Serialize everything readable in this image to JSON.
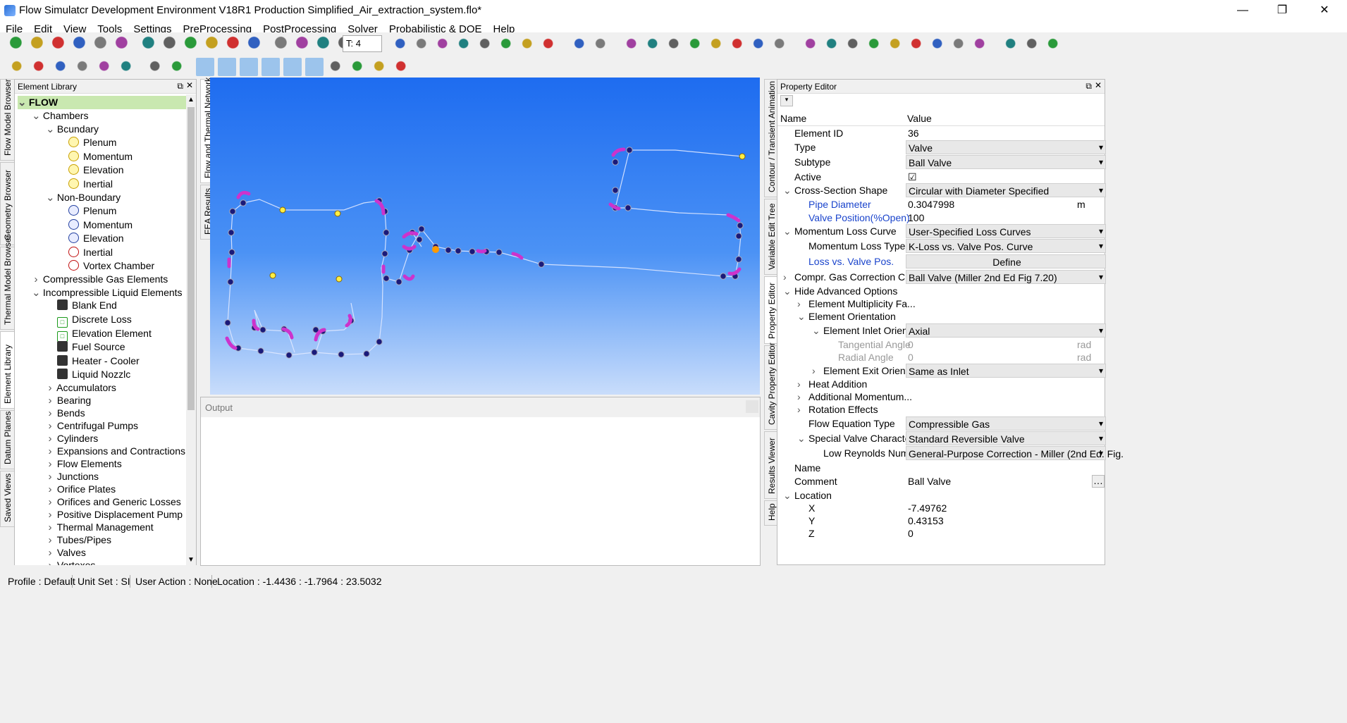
{
  "title": "Flow Simulatcr Development Environment V18R1 Production Simplified_Air_extraction_system.flo*",
  "menu": [
    "File",
    "Edit",
    "View",
    "Tools",
    "Settings",
    "PreProcessing",
    "PostProcessing",
    "Solver",
    "Probabilistic & DOE",
    "Help"
  ],
  "toolbar": {
    "text_size": "T: 4"
  },
  "left_tabs": [
    "Flow Model Browser",
    "Geometry Browser",
    "Thermal Model Browser",
    "Element Library",
    "Datum Planes",
    "Saved Views"
  ],
  "library": {
    "title": "Element Library",
    "root": "FLOW",
    "chambers": "Chambers",
    "boundary": "Bcundary",
    "boundary_items": [
      "Plenum",
      "Momentum",
      "Elevation",
      "Inertial"
    ],
    "nonboundary": "Non-Boundary",
    "nonboundary_items": [
      "Plenum",
      "Momentum",
      "Elevation",
      "Inertial",
      "Vortex Chamber"
    ],
    "compressible": "Compressible Gas Elements",
    "incompressible": "Incompressible Liquid Elements",
    "liquid_items": [
      "Blank End",
      "Discrete Loss",
      "Elevation Element",
      "Fuel Source",
      "Heater - Cooler",
      "Liquid Nozzlc"
    ],
    "groups": [
      "Accumulators",
      "Bearing",
      "Bends",
      "Centrifugal Pumps",
      "Cylinders",
      "Expansions and Contractions",
      "Flow Elements",
      "Junctions",
      "Orifice Plates",
      "Orifices and Generic Losses",
      "Positive Displacement Pump",
      "Thermal Management",
      "Tubes/Pipes",
      "Valves",
      "Vortexes"
    ]
  },
  "mid_tabs": [
    "Flow and Thermal Network",
    "FEA Results"
  ],
  "output": {
    "title": "Output"
  },
  "right_tabs": [
    "Contour / Transient Animation",
    "Variable Edit Tree",
    "Property Editor",
    "Cavity Property Editor",
    "Results Viewer",
    "Help"
  ],
  "props": {
    "title": "Property Editor",
    "col_name": "Name",
    "col_value": "Value",
    "rows": [
      {
        "n": "Element ID",
        "v": "36",
        "lvl": 1
      },
      {
        "n": "Type",
        "v": "Valve",
        "lvl": 1,
        "dd": true
      },
      {
        "n": "Subtype",
        "v": "Ball Valve",
        "lvl": 1,
        "dd": true
      },
      {
        "n": "Active",
        "v": "☑",
        "lvl": 1
      },
      {
        "n": "Cross-Section Shape",
        "v": "Circular with Diameter Specified",
        "lvl": 1,
        "dd": true,
        "exp": "v"
      },
      {
        "n": "Pipe Diameter",
        "v": "0.3047998",
        "unit": "m",
        "lvl": 2,
        "blue": true
      },
      {
        "n": "Valve Position(%Open)",
        "v": "100",
        "lvl": 2,
        "blue": true
      },
      {
        "n": "Momentum Loss Curve",
        "v": "User-Specified Loss Curves",
        "lvl": 1,
        "dd": true,
        "exp": "v"
      },
      {
        "n": "Momentum Loss Type",
        "v": "K-Loss vs. Valve Pos. Curve",
        "lvl": 2,
        "dd": true
      },
      {
        "n": "Loss vs. Valve Pos.",
        "v": "Define",
        "lvl": 2,
        "blue": true,
        "btn": true
      },
      {
        "n": "Compr. Gas Correction Curve",
        "v": "Ball Valve (Miller 2nd Ed Fig 7.20)",
        "lvl": 1,
        "dd": true,
        "exp": ">"
      },
      {
        "n": "Hide Advanced Options",
        "v": "",
        "lvl": 1,
        "exp": "v"
      },
      {
        "n": "Element Multiplicity Fa...",
        "v": "",
        "lvl": 2,
        "exp": ">"
      },
      {
        "n": "Element Orientation",
        "v": "",
        "lvl": 2,
        "exp": "v"
      },
      {
        "n": "Element Inlet Orien...",
        "v": "Axial",
        "lvl": 3,
        "dd": true,
        "exp": "v"
      },
      {
        "n": "Tangential Angle",
        "v": "0",
        "unit": "rad",
        "lvl": 4,
        "grey": true
      },
      {
        "n": "Radial Angle",
        "v": "0",
        "unit": "rad",
        "lvl": 4,
        "grey": true
      },
      {
        "n": "Element Exit Orient...",
        "v": "Same as Inlet",
        "lvl": 3,
        "dd": true,
        "exp": ">"
      },
      {
        "n": "Heat Addition",
        "v": "",
        "lvl": 2,
        "exp": ">"
      },
      {
        "n": "Additional Momentum...",
        "v": "",
        "lvl": 2,
        "exp": ">"
      },
      {
        "n": "Rotation Effects",
        "v": "",
        "lvl": 2,
        "exp": ">"
      },
      {
        "n": "Flow Equation Type",
        "v": "Compressible Gas",
        "lvl": 2,
        "dd": true
      },
      {
        "n": "Special Valve Characte...",
        "v": "Standard Reversible Valve",
        "lvl": 2,
        "dd": true,
        "exp": "v"
      },
      {
        "n": "Low Reynolds Num...",
        "v": "General-Purpose Correction - Miller (2nd Ed. Fig.",
        "lvl": 3,
        "dd": true
      },
      {
        "n": "Name",
        "v": "",
        "lvl": 1
      },
      {
        "n": "Comment",
        "v": "Ball Valve",
        "lvl": 1,
        "more": true
      },
      {
        "n": "Location",
        "v": "",
        "lvl": 1,
        "exp": "v"
      },
      {
        "n": "X",
        "v": "-7.49762",
        "lvl": 2
      },
      {
        "n": "Y",
        "v": "0.43153",
        "lvl": 2
      },
      {
        "n": "Z",
        "v": "0",
        "lvl": 2
      }
    ]
  },
  "status": {
    "profile": "Profile : Default",
    "units": "Unit Set : SI",
    "action": "User Action : None",
    "location": "Location : -1.4436 : -1.7964 : 23.5032"
  }
}
